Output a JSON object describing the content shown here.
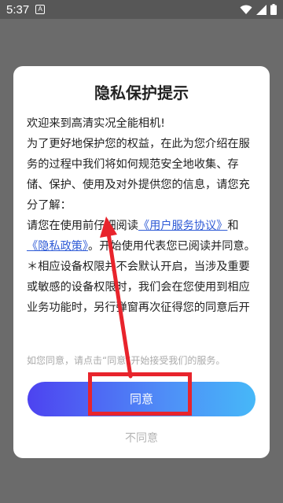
{
  "status_bar": {
    "time": "5:37",
    "app_icon": "A"
  },
  "dialog": {
    "title": "隐私保护提示",
    "welcome": "欢迎来到高清实况全能相机!",
    "intro": "为了更好地保护您的权益，在此为您介绍在服务的过程中我们将如何规范安全地收集、存储、保护、使用及对外提供您的信息，请您充分了解：",
    "read_prefix": "请您在使用前仔细阅读",
    "user_agreement_link": "《用户服务协议》",
    "and_text": "和",
    "privacy_policy_link": "《隐私政策》",
    "read_suffix": "。开始使用代表您已阅读并同意。",
    "permission_note": "＊相应设备权限并不会默认开启，当涉及重要或敏感的设备权限时，我们会在您使用到相应业务功能时，另行弹窗再次征得您的同意后开",
    "faded_line": "如您同意，请点击“同意”开始接受我们的服务。",
    "agree_label": "同意",
    "disagree_label": "不同意"
  },
  "colors": {
    "overlay": "#6b6b6b",
    "link": "#2f5bd6",
    "annotation_red": "#e8242c"
  },
  "icons": {
    "wifi": "wifi-icon",
    "signal": "signal-icon",
    "battery": "battery-icon"
  }
}
